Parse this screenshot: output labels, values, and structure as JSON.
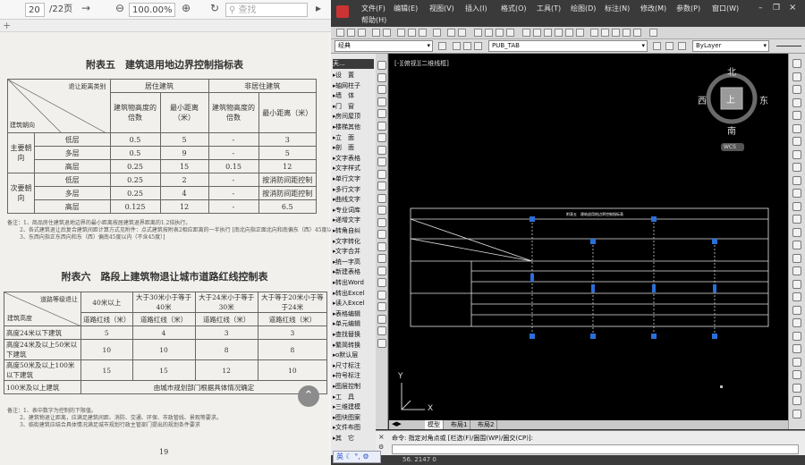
{
  "pdf_viewer": {
    "page_input": "20",
    "page_total": "/22页",
    "zoom": "100.00%",
    "find_placeholder": "查找"
  },
  "document": {
    "table5": {
      "caption": "附表五　建筑退用地边界控制指标表",
      "rows": [
        [
          "主要朝向",
          "低层",
          "0.5",
          "5",
          "-",
          "3"
        ],
        [
          "",
          "多层",
          "0.5",
          "9",
          "-",
          "5"
        ],
        [
          "",
          "高层",
          "0.25",
          "15",
          "0.15",
          "12"
        ],
        [
          "次要朝向",
          "低层",
          "0.25",
          "2",
          "-",
          "按消防间距控制"
        ],
        [
          "",
          "多层",
          "0.25",
          "4",
          "-",
          "按消防间距控制"
        ],
        [
          "",
          "高层",
          "0.125",
          "12",
          "-",
          "6.5"
        ]
      ],
      "headers": {
        "residential": "居住建筑",
        "nonresidential": "非居住建筑",
        "ratio": "建筑物高度的倍数",
        "min_dist": "最小距离（米）",
        "corner_top": "退让距离类别",
        "corner_bottom": "建筑朝向"
      },
      "note1": "备注：1、商品房住建筑退地边界的最小距离按居建筑退界距离的1.2倍执行。",
      "note2": "2、各式建筑退让后复合建筑间距计算方式见附件：点式建筑按附表2相应距离的一半执行 [南北向指正面北向和南偏东（西）45度以内（含）；",
      "note3": "3、东西向指正东西向和东（西）偏南45度以内（不含45度）]"
    },
    "table6": {
      "caption": "附表六　路段上建筑物退让城市道路红线控制表",
      "corner_top": "道路等级退让",
      "corner_bottom": "建筑高度",
      "col_heads": [
        "40米以上",
        "大于30米小于等于40米",
        "大于24米小于等于30米",
        "大于等于20米小于等于24米"
      ],
      "subhead": "道路红线（米）",
      "rows": [
        [
          "高度24米以下建筑",
          "5",
          "4",
          "3",
          "3"
        ],
        [
          "高度24米及以上50米以下建筑",
          "10",
          "10",
          "8",
          "8"
        ],
        [
          "高度50米及以上100米以下建筑",
          "15",
          "15",
          "12",
          "10"
        ]
      ],
      "last_row_label": "100米及以上建筑",
      "last_row_value": "由城市规划部门根据具体情况确定",
      "note1": "备注：1、表中数字为控制的下限值。",
      "note2": "2、建筑物退让距离，应满足建筑间距、消防、交通、环保、市政管线、景观等要求。",
      "note3": "3、临街建筑应结合具体情况满足城市规划行政主管部门提出的规划条件要求"
    },
    "page_number": "19"
  },
  "cad": {
    "menu_top": [
      "文件(F)",
      "编辑(E)",
      "视图(V)",
      "插入(I)",
      "格式(O)",
      "工具(T)",
      "绘图(D)",
      "标注(N)",
      "修改(M)",
      "参数(P)",
      "窗口(W)"
    ],
    "menu_second": "帮助(H)",
    "workspace": "经典",
    "text_style": "PUB_TAB",
    "layer": "ByLayer",
    "viewport_label": "[-][俯视][二维线框]",
    "sidebar_title": "天...",
    "sidebar_items": [
      "设　置",
      "轴网柱子",
      "墙　体",
      "门　窗",
      "房间屋顶",
      "楼梯其他",
      "立　面",
      "剖　面",
      "文字表格",
      "文字样式",
      "单行文字",
      "多行文字",
      "曲线文字",
      "专业词库",
      "递增文字",
      "转角自纠",
      "文字转化",
      "文字合并",
      "统一字高",
      "新建表格",
      "转出Word",
      "转出Excel",
      "读入Excel",
      "表格编辑",
      "单元编辑",
      "查找替换",
      "繁简转换",
      "o默认层",
      "尺寸标注",
      "符号标注",
      "图层控制",
      "工　具",
      "三维建模",
      "图块图案",
      "文件布图",
      "其　它"
    ],
    "viewcube": {
      "n": "北",
      "s": "南",
      "e": "东",
      "w": "西",
      "top": "上",
      "wcs": "WCS"
    },
    "drawing_title": "附表五　建筑退用地边界控制指标表",
    "ucs_x": "X",
    "ucs_y": "Y",
    "tabs": [
      "模型",
      "布局1",
      "布局2"
    ],
    "command_line": "命令: 指定对角点或 [栏选(F)/圈围(WP)/圈交(CP)]:",
    "ime": "英",
    "status_left": "56. 2147 0"
  }
}
